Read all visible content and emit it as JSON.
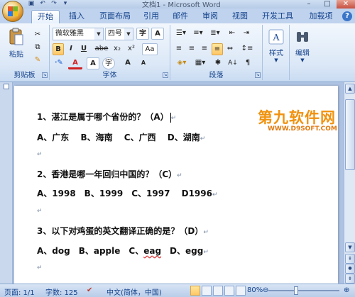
{
  "window": {
    "title": "文档1 - Microsoft Word"
  },
  "quick_access": [
    "save-icon",
    "undo-icon",
    "redo-icon",
    "customize-icon"
  ],
  "tabs": [
    "开始",
    "插入",
    "页面布局",
    "引用",
    "邮件",
    "审阅",
    "视图",
    "开发工具",
    "加载项"
  ],
  "ribbon": {
    "clipboard": {
      "paste": "粘贴",
      "label": "剪贴板"
    },
    "font": {
      "name": "微软雅黑",
      "size": "四号",
      "grow": "A",
      "shrink": "A",
      "label": "字体",
      "bold": "B",
      "italic": "I",
      "underline": "U",
      "strike": "abe",
      "subscript": "x₂",
      "superscript": "x²",
      "case": "Aa",
      "color_a": "A",
      "char_border": "A",
      "enclose": "字",
      "phonetic": "字"
    },
    "paragraph": {
      "label": "段落",
      "sort": "A↓",
      "marks": "¶"
    },
    "styles": {
      "label": "样式"
    },
    "editing": {
      "label": "编辑"
    }
  },
  "document": {
    "lines": [
      "1、湛江是属于哪个省份的？（A）",
      "A、广东　 B、海南　 C、广西　 D、湖南",
      "2、香港是哪一年回归中国的？（C）",
      "A、1998　B、1999　C、1997　 D1996",
      "3、以下对鸡蛋的英文翻译正确的是？（D）"
    ],
    "line6_a": "A、dog　B、apple　C、",
    "line6_typo": "eag",
    "line6_b": "　D、egg",
    "pilcrow": "↵"
  },
  "watermark": {
    "main": "第九软件网",
    "sub": "WWW.D9SOFT.COM"
  },
  "status": {
    "page": "页面: 1/1",
    "words": "字数: 125",
    "language": "中文(简体，中国)",
    "zoom": "80%",
    "zoom_level": 0.8
  },
  "colors": {
    "accent": "#15428b",
    "ribbon": "#dce8f7",
    "watermark": "#f0920f"
  }
}
